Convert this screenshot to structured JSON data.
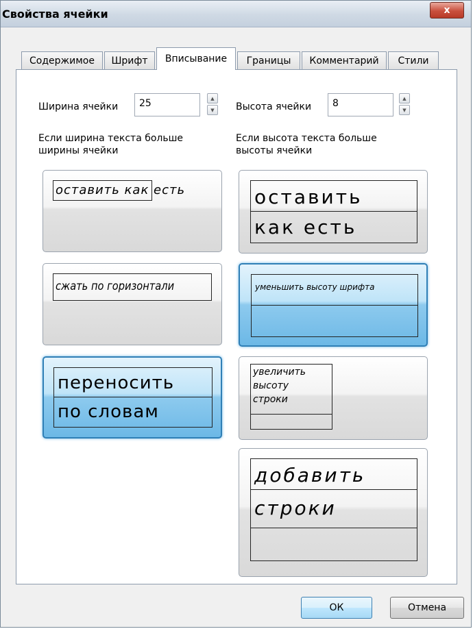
{
  "window": {
    "title": "Свойства ячейки",
    "close_label": "x"
  },
  "tabs": [
    {
      "label": "Содержимое",
      "active": false
    },
    {
      "label": "Шрифт",
      "active": false
    },
    {
      "label": "Вписывание",
      "active": true
    },
    {
      "label": "Границы",
      "active": false
    },
    {
      "label": "Комментарий",
      "active": false
    },
    {
      "label": "Стили",
      "active": false
    }
  ],
  "width_field": {
    "label": "Ширина ячейки",
    "value": "25"
  },
  "height_field": {
    "label": "Высота ячейки",
    "value": "8"
  },
  "width_group": {
    "heading_line1": "Если ширина текста больше",
    "heading_line2": "ширины ячейки",
    "options": [
      {
        "text": "оставить как есть",
        "selected": false
      },
      {
        "text": "сжать по горизонтали",
        "selected": false
      },
      {
        "line1": "переносить",
        "line2": "по словам",
        "selected": true
      }
    ]
  },
  "height_group": {
    "heading_line1": "Если высота текста больше",
    "heading_line2": "высоты ячейки",
    "options": [
      {
        "line1": "оставить",
        "line2": "как есть",
        "selected": false
      },
      {
        "text": "уменьшить высоту шрифта",
        "selected": true
      },
      {
        "line1": "увеличить",
        "line2": "высоту",
        "line3": "строки",
        "selected": false
      },
      {
        "line1": "добавить",
        "line2": "строки",
        "selected": false
      }
    ]
  },
  "buttons": {
    "ok": "ОК",
    "cancel": "Отмена"
  },
  "icons": {
    "spin_up": "▲",
    "spin_down": "▼"
  }
}
